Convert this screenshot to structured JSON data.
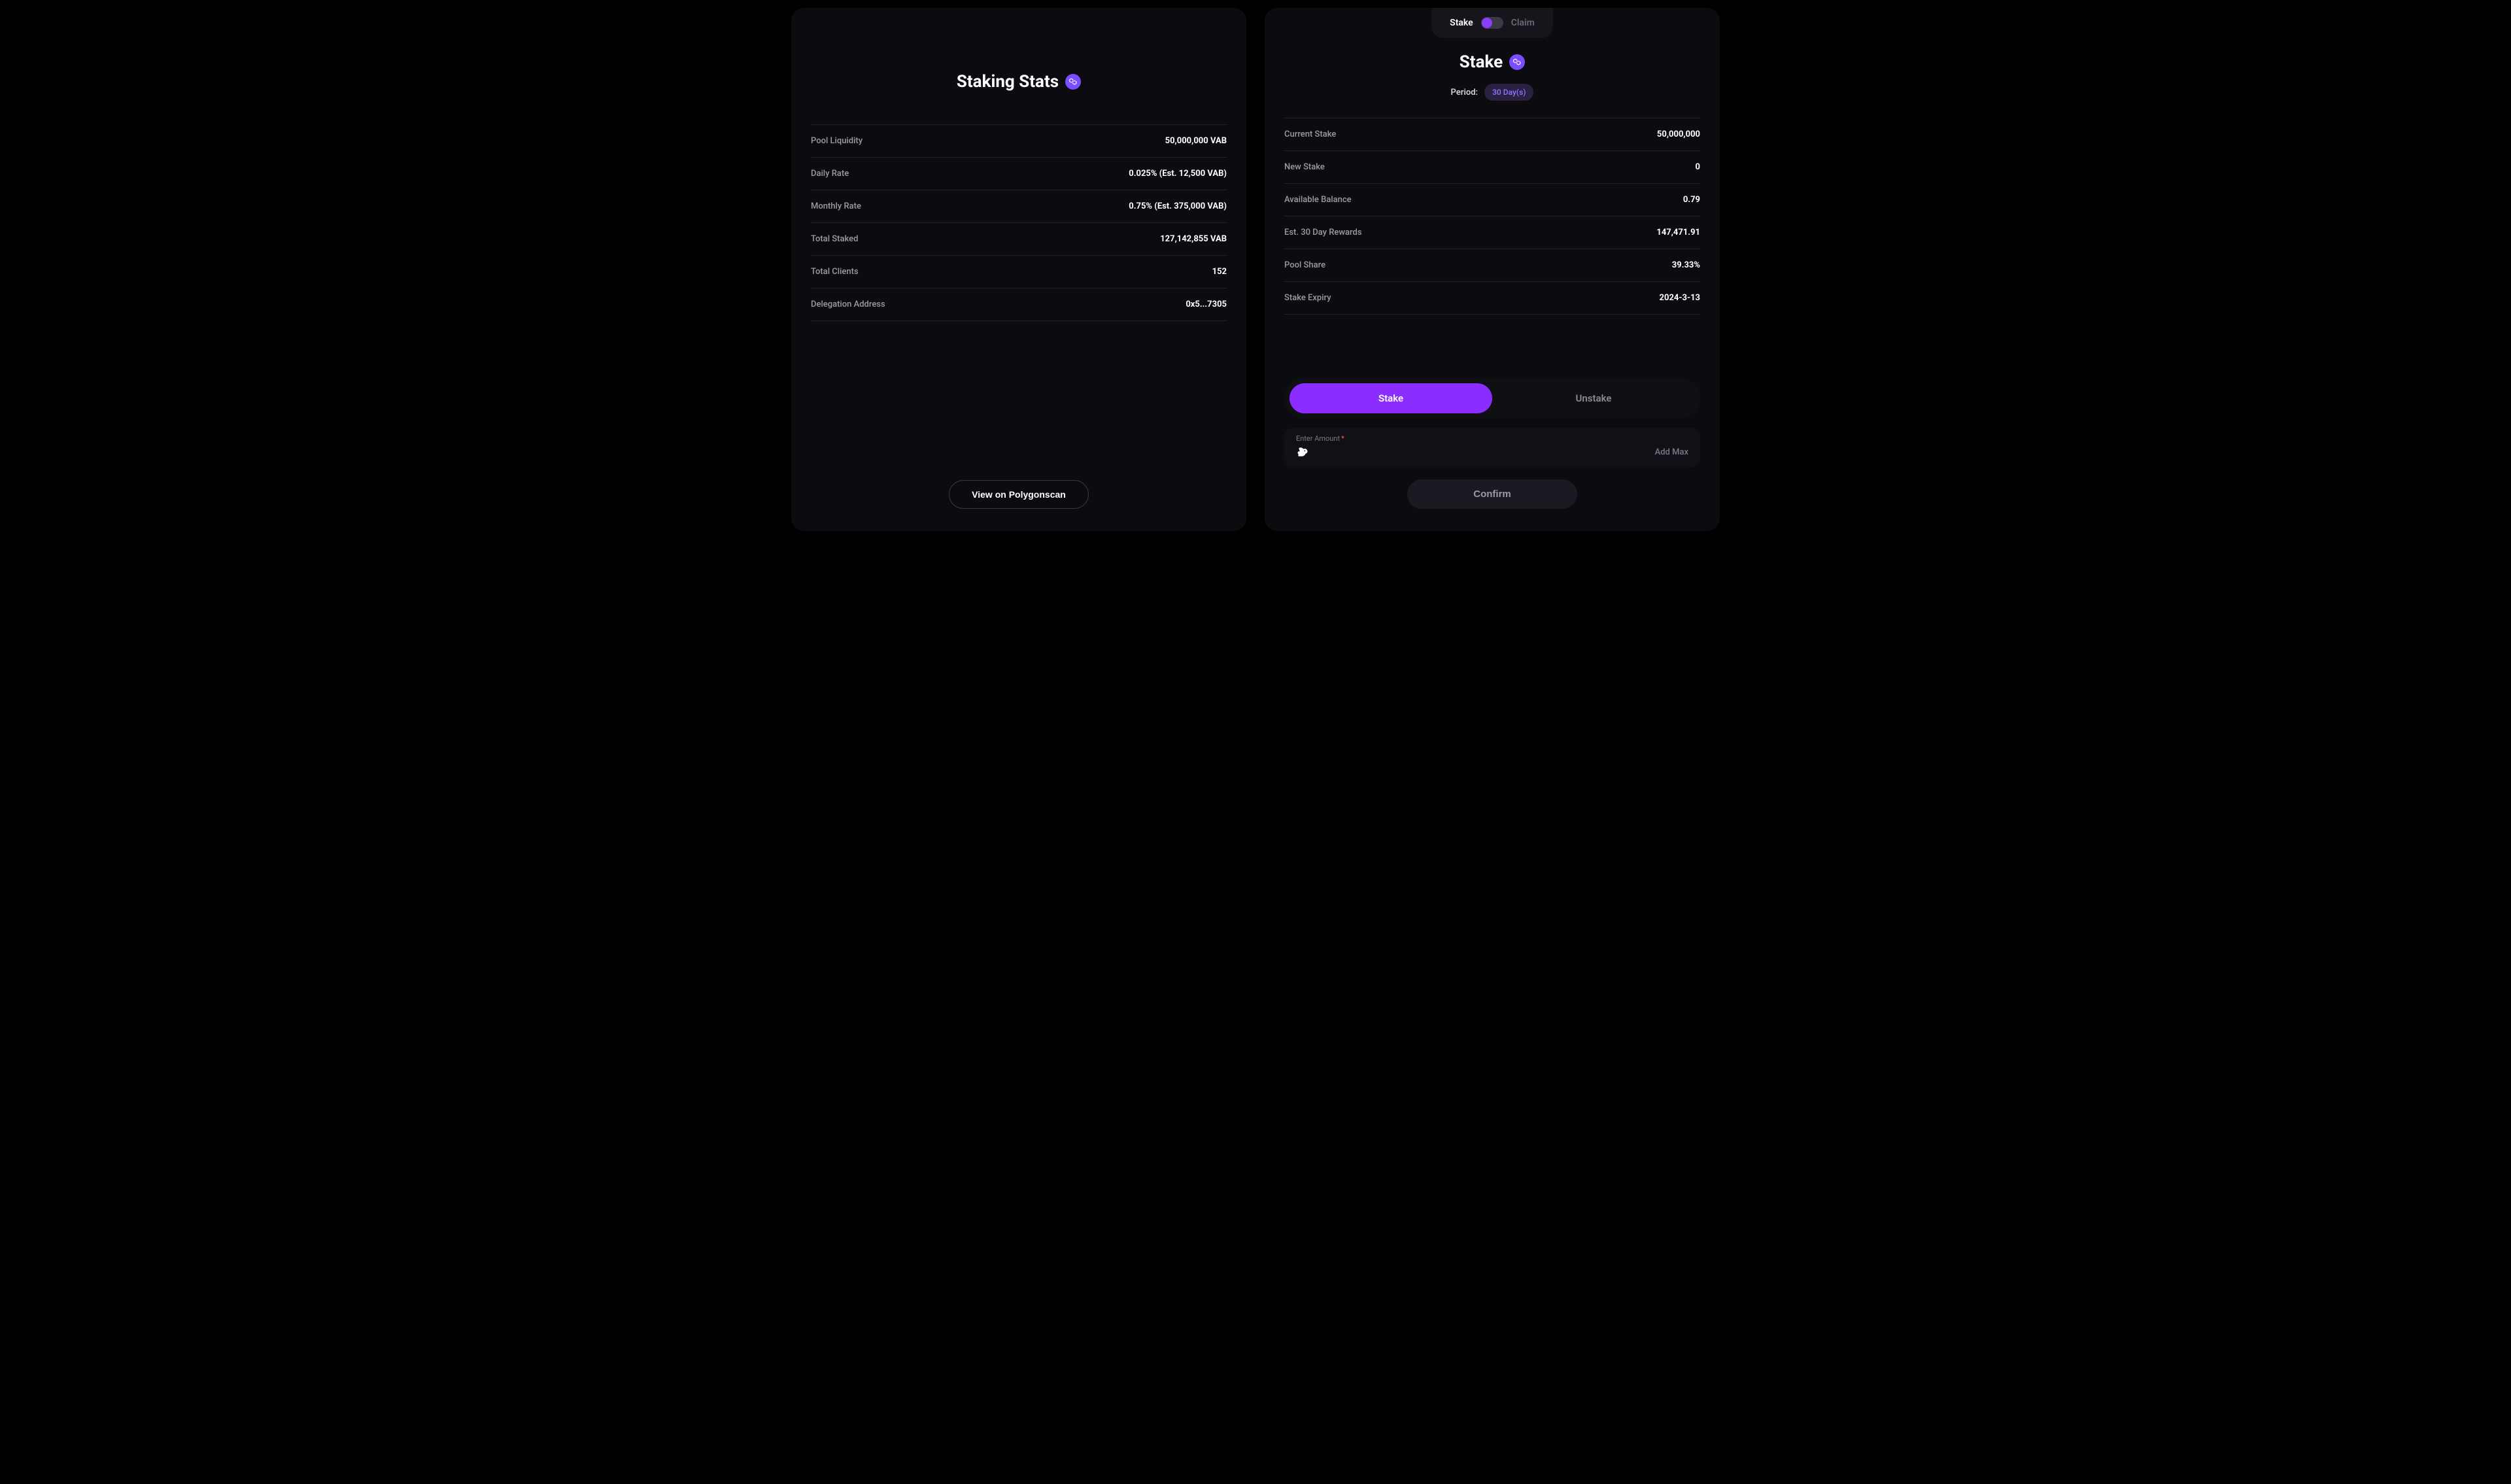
{
  "left": {
    "title": "Staking Stats",
    "rows": [
      {
        "label": "Pool Liquidity",
        "value": "50,000,000 VAB"
      },
      {
        "label": "Daily Rate",
        "value": "0.025% (Est. 12,500 VAB)"
      },
      {
        "label": "Monthly Rate",
        "value": "0.75% (Est. 375,000 VAB)"
      },
      {
        "label": "Total Staked",
        "value": "127,142,855 VAB"
      },
      {
        "label": "Total Clients",
        "value": "152"
      },
      {
        "label": "Delegation Address",
        "value": "0x5...7305"
      }
    ],
    "view_btn": "View on Polygonscan"
  },
  "right": {
    "toggle": {
      "left": "Stake",
      "right": "Claim"
    },
    "title": "Stake",
    "period_label": "Period:",
    "period_value": "30 Day(s)",
    "rows": [
      {
        "label": "Current Stake",
        "value": "50,000,000"
      },
      {
        "label": "New Stake",
        "value": "0"
      },
      {
        "label": "Available Balance",
        "value": "0.79"
      },
      {
        "label": "Est. 30 Day Rewards",
        "value": "147,471.91"
      },
      {
        "label": "Pool Share",
        "value": "39.33%"
      },
      {
        "label": "Stake Expiry",
        "value": "2024-3-13"
      }
    ],
    "tabs": {
      "stake": "Stake",
      "unstake": "Unstake"
    },
    "input": {
      "label": "Enter Amount",
      "required": "*",
      "add_max": "Add Max",
      "placeholder": ""
    },
    "confirm": "Confirm"
  }
}
